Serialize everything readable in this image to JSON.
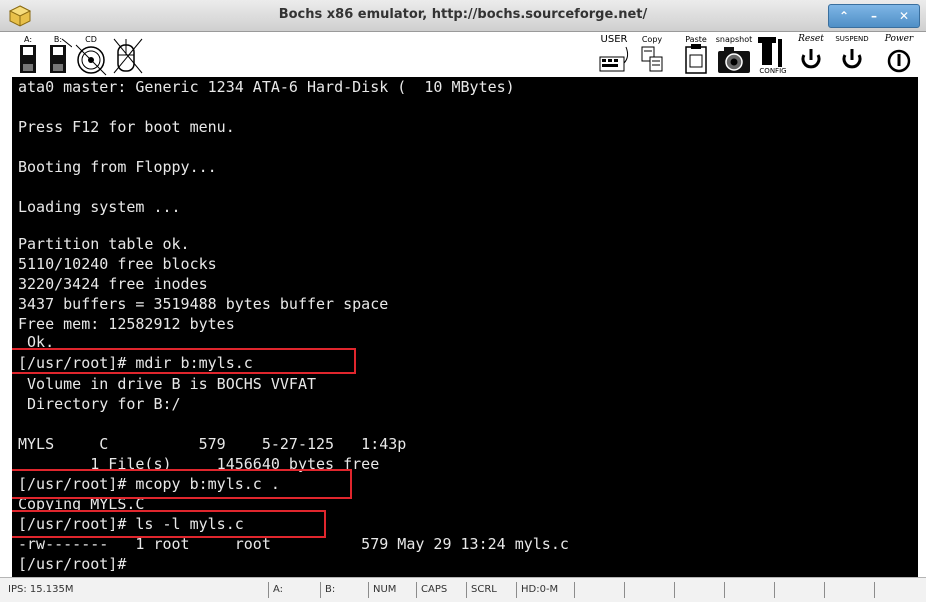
{
  "window": {
    "title": "Bochs x86 emulator, http://bochs.sourceforge.net/",
    "controls": [
      "⌃",
      "–",
      "✕"
    ]
  },
  "toolbar": {
    "floppy_a_label": "A:",
    "floppy_b_label": "B:",
    "cdrom_label": "CD",
    "user_label": "USER",
    "copy_label": "Copy",
    "paste_label": "Paste",
    "snapshot_label": "snapshot",
    "config_label": "CONFIG",
    "reset_label": "Reset",
    "suspend_label": "SUSPEND",
    "power_label": "Power"
  },
  "terminal": {
    "lines": [
      "ata0 master: Generic 1234 ATA-6 Hard-Disk (  10 MBytes)",
      "",
      "Press F12 for boot menu.",
      "",
      "Booting from Floppy...",
      "",
      "Loading system ...",
      "",
      "Partition table ok.",
      "5110/10240 free blocks",
      "3220/3424 free inodes",
      "3437 buffers = 3519488 bytes buffer space",
      "Free mem: 12582912 bytes",
      " Ok.",
      "[/usr/root]# mdir b:myls.c",
      " Volume in drive B is BOCHS VVFAT",
      " Directory for B:/",
      "",
      "MYLS     C          579    5-27-125   1:43p",
      "        1 File(s)     1456640 bytes free",
      "[/usr/root]# mcopy b:myls.c .",
      "Copying MYLS.C",
      "[/usr/root]# ls -l myls.c",
      "-rw-------   1 root     root          579 May 29 13:24 myls.c",
      "[/usr/root]#"
    ]
  },
  "statusbar": {
    "ips": "IPS: 15.135M",
    "drive_a": "A:",
    "drive_b": "B:",
    "num": "NUM",
    "caps": "CAPS",
    "scrl": "SCRL",
    "hd": "HD:0-M"
  }
}
